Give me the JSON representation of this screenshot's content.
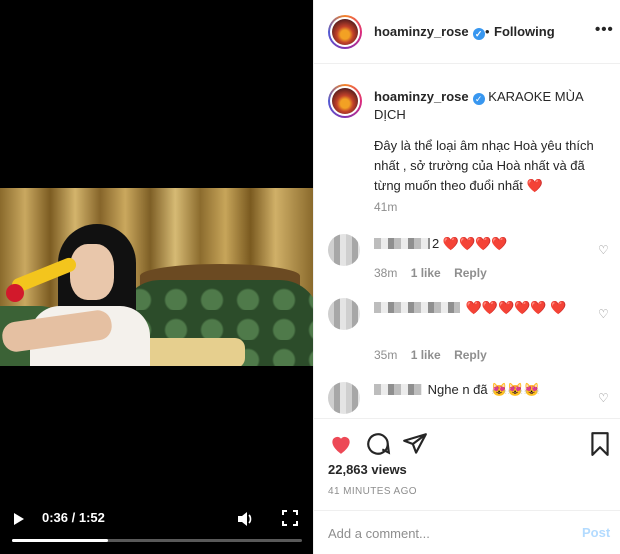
{
  "video": {
    "timecode": "0:36 / 1:52",
    "progress_fraction": 0.33
  },
  "header": {
    "username": "hoaminzy_rose",
    "separator": "•",
    "follow_label": "Following",
    "more_label": "•••"
  },
  "caption": {
    "username": "hoaminzy_rose",
    "title": "KARAOKE MÙA DỊCH",
    "body": "Đây là thể loại âm nhạc Hoà yêu thích nhất , sở trường của Hoà nhất và đã từng muốn theo đuổi nhất",
    "heart": "❤️",
    "time": "41m"
  },
  "comments": [
    {
      "name_suffix": "2",
      "text": "❤️❤️❤️❤️",
      "time": "38m",
      "likes": "1 like",
      "reply": "Reply"
    },
    {
      "name_suffix": "",
      "text": "❤️❤️❤️❤️❤️ ❤️",
      "time": "35m",
      "likes": "1 like",
      "reply": "Reply"
    },
    {
      "name_suffix": "",
      "text": "Nghe n đã 😻😻😻"
    }
  ],
  "stats": {
    "views": "22,863 views",
    "posted": "41 MINUTES AGO"
  },
  "add_comment": {
    "placeholder": "Add a comment...",
    "post_label": "Post"
  },
  "colors": {
    "verified": "#3897f0",
    "like_active": "#ed4956",
    "post_disabled": "#b3dbff"
  }
}
